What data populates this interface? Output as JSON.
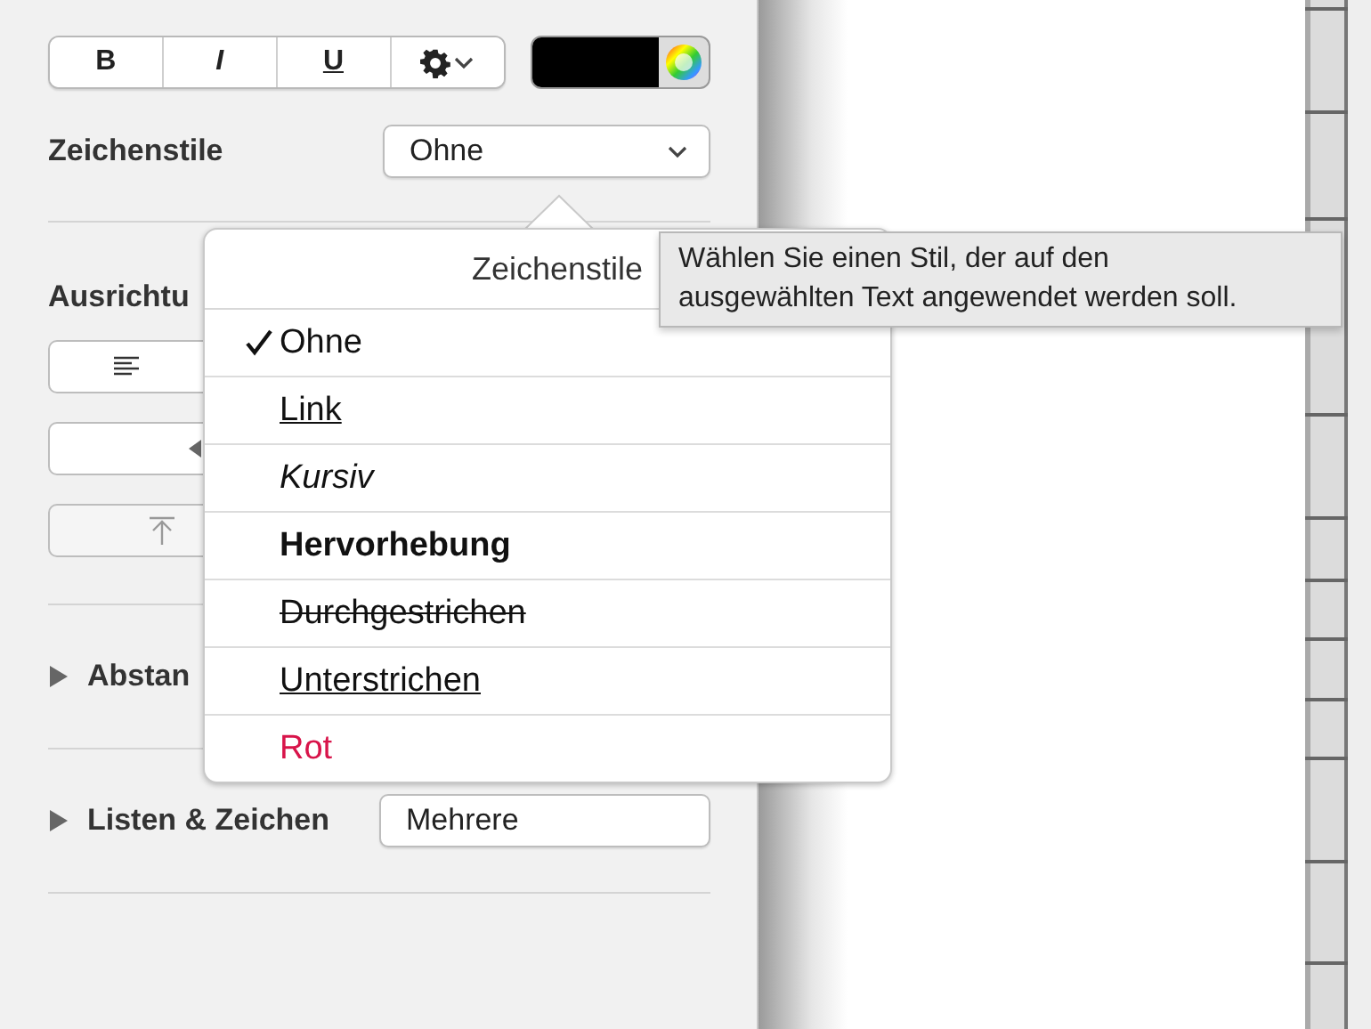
{
  "sidebar": {
    "format_buttons": [
      {
        "kind": "bold",
        "label": "B"
      },
      {
        "kind": "italic",
        "label": "I"
      },
      {
        "kind": "underline",
        "label": "U"
      },
      {
        "kind": "gear"
      }
    ],
    "character_style": {
      "label": "Zeichenstile",
      "value": "Ohne"
    },
    "alignment": {
      "label": "Ausrichtu"
    },
    "sections": [
      {
        "label": "Abstan",
        "expanded": false
      },
      {
        "label": "Listen & Zeichen",
        "expanded": false,
        "value": "Mehrere"
      }
    ]
  },
  "popover": {
    "title": "Zeichenstile",
    "items": [
      {
        "label": "Ohne",
        "kind": "plain",
        "selected": true
      },
      {
        "label": "Link",
        "kind": "link",
        "selected": false
      },
      {
        "label": "Kursiv",
        "kind": "italic",
        "selected": false
      },
      {
        "label": "Hervorhebung",
        "kind": "bold",
        "selected": false
      },
      {
        "label": "Durchgestrichen",
        "kind": "strike",
        "selected": false
      },
      {
        "label": "Unterstrichen",
        "kind": "underline",
        "selected": false
      },
      {
        "label": "Rot",
        "kind": "colored",
        "color": "#d8144a",
        "selected": false
      }
    ]
  },
  "tooltip": {
    "lines": [
      "Wählen Sie einen Stil, der auf den",
      "ausgewählten Text angewendet werden soll."
    ]
  }
}
